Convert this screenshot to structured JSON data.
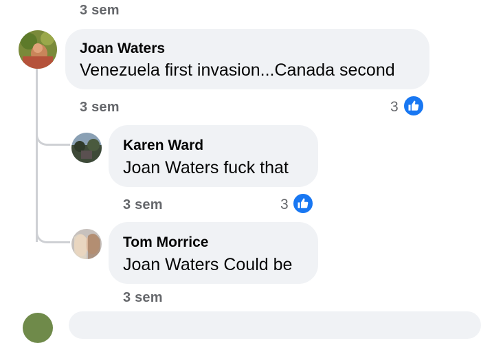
{
  "top_comment": {
    "time": "3 sem"
  },
  "comments": [
    {
      "author": "Joan Waters",
      "text": "Venezuela first invasion...Canada second",
      "time": "3 sem",
      "likes": "3"
    }
  ],
  "replies": [
    {
      "author": "Karen Ward",
      "text": "Joan Waters fuck that",
      "time": "3 sem",
      "likes": "3"
    },
    {
      "author": "Tom Morrice",
      "text": "Joan Waters Could be",
      "time": "3 sem"
    }
  ],
  "colors": {
    "like_blue": "#1877f2",
    "bubble": "#f0f2f5",
    "meta": "#65676b",
    "thread_line": "#ced0d4"
  },
  "icons": {
    "like": "thumbs-up-icon"
  }
}
